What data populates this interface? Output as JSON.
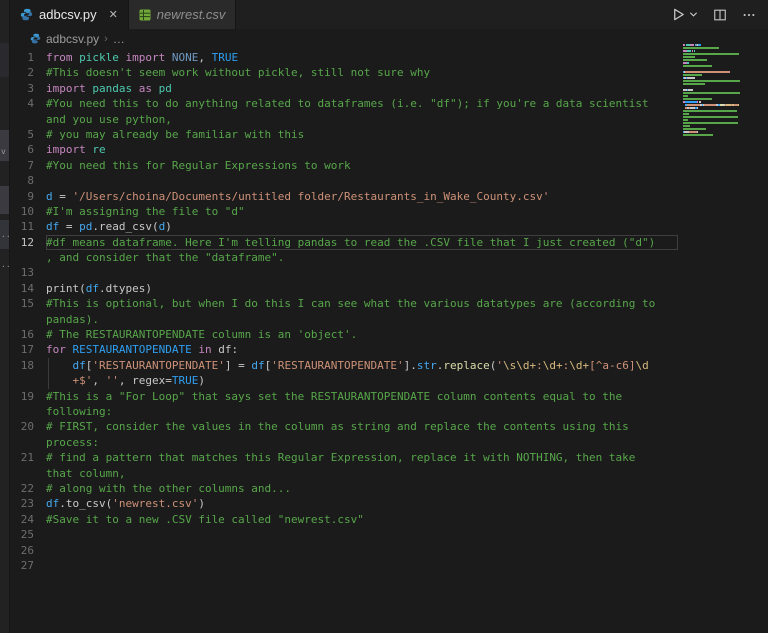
{
  "sidebar": {
    "fragments": [
      "v",
      "..",
      ".."
    ]
  },
  "tabs": [
    {
      "label": "adbcsv.py",
      "close_glyph": "✕"
    },
    {
      "label": "newrest.csv"
    }
  ],
  "breadcrumb": {
    "file": "adbcsv.py",
    "separator": "›",
    "more": "…"
  },
  "colors": {
    "kw": "#C586C0",
    "mod": "#4EC9B0",
    "var": "#44A8F0",
    "cst": "#2E9FF2",
    "mut": "#6E9AC3",
    "cm": "#57A64A",
    "str": "#CE9178",
    "esc": "#D7BA7D",
    "fn": "#DCDCAA",
    "w": "#C8C8C8",
    "lineNumber": "#6D6D6D",
    "activeLineNumber": "#C6C6C6"
  },
  "editor": {
    "rows": [
      {
        "n": "1",
        "segs": [
          [
            "kw",
            "from"
          ],
          [
            "w",
            " "
          ],
          [
            "mod",
            "pickle"
          ],
          [
            "w",
            " "
          ],
          [
            "kw",
            "import"
          ],
          [
            "w",
            " "
          ],
          [
            "mut",
            "NONE"
          ],
          [
            "w",
            ", "
          ],
          [
            "cst",
            "TRUE"
          ]
        ]
      },
      {
        "n": "2",
        "segs": [
          [
            "cm",
            "#This doesn't seem work without pickle, still not sure why"
          ]
        ]
      },
      {
        "n": "3",
        "segs": [
          [
            "kw",
            "import"
          ],
          [
            "w",
            " "
          ],
          [
            "mod",
            "pandas"
          ],
          [
            "w",
            " "
          ],
          [
            "kw",
            "as"
          ],
          [
            "w",
            " "
          ],
          [
            "mod",
            "pd"
          ]
        ]
      },
      {
        "n": "4",
        "segs": [
          [
            "cm",
            "#You need this to do anything related to dataframes (i.e. \"df\"); if you're a data scientist"
          ]
        ]
      },
      {
        "n": "",
        "segs": [
          [
            "cm",
            "and you use python,"
          ]
        ]
      },
      {
        "n": "5",
        "segs": [
          [
            "cm",
            "# you may already be familiar with this"
          ]
        ]
      },
      {
        "n": "6",
        "segs": [
          [
            "kw",
            "import"
          ],
          [
            "w",
            " "
          ],
          [
            "mod",
            "re"
          ]
        ]
      },
      {
        "n": "7",
        "segs": [
          [
            "cm",
            "#You need this for Regular Expressions to work"
          ]
        ]
      },
      {
        "n": "8",
        "segs": []
      },
      {
        "n": "9",
        "segs": [
          [
            "var",
            "d"
          ],
          [
            "w",
            " = "
          ],
          [
            "str",
            "'/Users/choina/Documents/untitled folder/Restaurants_in_Wake_County.csv'"
          ]
        ]
      },
      {
        "n": "10",
        "segs": [
          [
            "cm",
            "#I'm assigning the file to \"d\""
          ]
        ]
      },
      {
        "n": "11",
        "segs": [
          [
            "var",
            "df"
          ],
          [
            "w",
            " = "
          ],
          [
            "var",
            "pd"
          ],
          [
            "w",
            ".read_csv("
          ],
          [
            "var",
            "d"
          ],
          [
            "w",
            ")"
          ]
        ]
      },
      {
        "n": "12",
        "cur": true,
        "segs": [
          [
            "cm",
            "#df means dataframe. Here I'm telling pandas to read the .CSV file that I just created (\"d\")"
          ]
        ]
      },
      {
        "n": "",
        "segs": [
          [
            "cm",
            ", and consider that the \"dataframe\"."
          ]
        ]
      },
      {
        "n": "13",
        "segs": []
      },
      {
        "n": "14",
        "segs": [
          [
            "w",
            "print("
          ],
          [
            "var",
            "df"
          ],
          [
            "w",
            ".dtypes)"
          ]
        ]
      },
      {
        "n": "15",
        "segs": [
          [
            "cm",
            "#This is optional, but when I do this I can see what the various datatypes are (according to"
          ]
        ]
      },
      {
        "n": "",
        "segs": [
          [
            "cm",
            "pandas)."
          ]
        ]
      },
      {
        "n": "16",
        "segs": [
          [
            "cm",
            "# The RESTAURANTOPENDATE column is an 'object'."
          ]
        ]
      },
      {
        "n": "17",
        "segs": [
          [
            "kw",
            "for"
          ],
          [
            "w",
            " "
          ],
          [
            "cst",
            "RESTAURANTOPENDATE"
          ],
          [
            "w",
            " "
          ],
          [
            "kw",
            "in"
          ],
          [
            "w",
            " "
          ],
          [
            "w",
            "df:"
          ]
        ]
      },
      {
        "n": "18",
        "g": true,
        "segs": [
          [
            "w",
            "    "
          ],
          [
            "var",
            "df"
          ],
          [
            "w",
            "["
          ],
          [
            "str",
            "'RESTAURANTOPENDATE'"
          ],
          [
            "w",
            "] = "
          ],
          [
            "var",
            "df"
          ],
          [
            "w",
            "["
          ],
          [
            "str",
            "'RESTAURANTOPENDATE'"
          ],
          [
            "w",
            "]."
          ],
          [
            "var",
            "str"
          ],
          [
            "w",
            "."
          ],
          [
            "fn",
            "replace"
          ],
          [
            "w",
            "("
          ],
          [
            "str",
            "'"
          ],
          [
            "esc",
            "\\s"
          ],
          [
            "esc",
            "\\d+"
          ],
          [
            "str",
            ":"
          ],
          [
            "esc",
            "\\d+"
          ],
          [
            "str",
            ":"
          ],
          [
            "esc",
            "\\d+"
          ],
          [
            "str",
            "[^a-c6]"
          ],
          [
            "esc",
            "\\d"
          ]
        ]
      },
      {
        "n": "",
        "g": true,
        "segs": [
          [
            "w",
            "    "
          ],
          [
            "str",
            "+$'"
          ],
          [
            "w",
            ", "
          ],
          [
            "str",
            "''"
          ],
          [
            "w",
            ", regex="
          ],
          [
            "cst",
            "TRUE"
          ],
          [
            "w",
            ")"
          ]
        ]
      },
      {
        "n": "19",
        "segs": [
          [
            "cm",
            "#This is a \"For Loop\" that says set the RESTAURANTOPENDATE column contents equal to the"
          ]
        ]
      },
      {
        "n": "",
        "segs": [
          [
            "cm",
            "following:"
          ]
        ]
      },
      {
        "n": "20",
        "segs": [
          [
            "cm",
            "# FIRST, consider the values in the column as string and replace the contents using this"
          ]
        ]
      },
      {
        "n": "",
        "segs": [
          [
            "cm",
            "process:"
          ]
        ]
      },
      {
        "n": "21",
        "segs": [
          [
            "cm",
            "# find a pattern that matches this Regular Expression, replace it with NOTHING, then take"
          ]
        ]
      },
      {
        "n": "",
        "segs": [
          [
            "cm",
            "that column,"
          ]
        ]
      },
      {
        "n": "22",
        "segs": [
          [
            "cm",
            "# along with the other columns and..."
          ]
        ]
      },
      {
        "n": "23",
        "segs": [
          [
            "var",
            "df"
          ],
          [
            "w",
            ".to_csv("
          ],
          [
            "str",
            "'newrest.csv'"
          ],
          [
            "w",
            ")"
          ]
        ]
      },
      {
        "n": "24",
        "segs": [
          [
            "cm",
            "#Save it to a new .CSV file called \"newrest.csv\""
          ]
        ]
      },
      {
        "n": "25",
        "segs": []
      },
      {
        "n": "26",
        "segs": []
      },
      {
        "n": "27",
        "segs": []
      }
    ]
  }
}
